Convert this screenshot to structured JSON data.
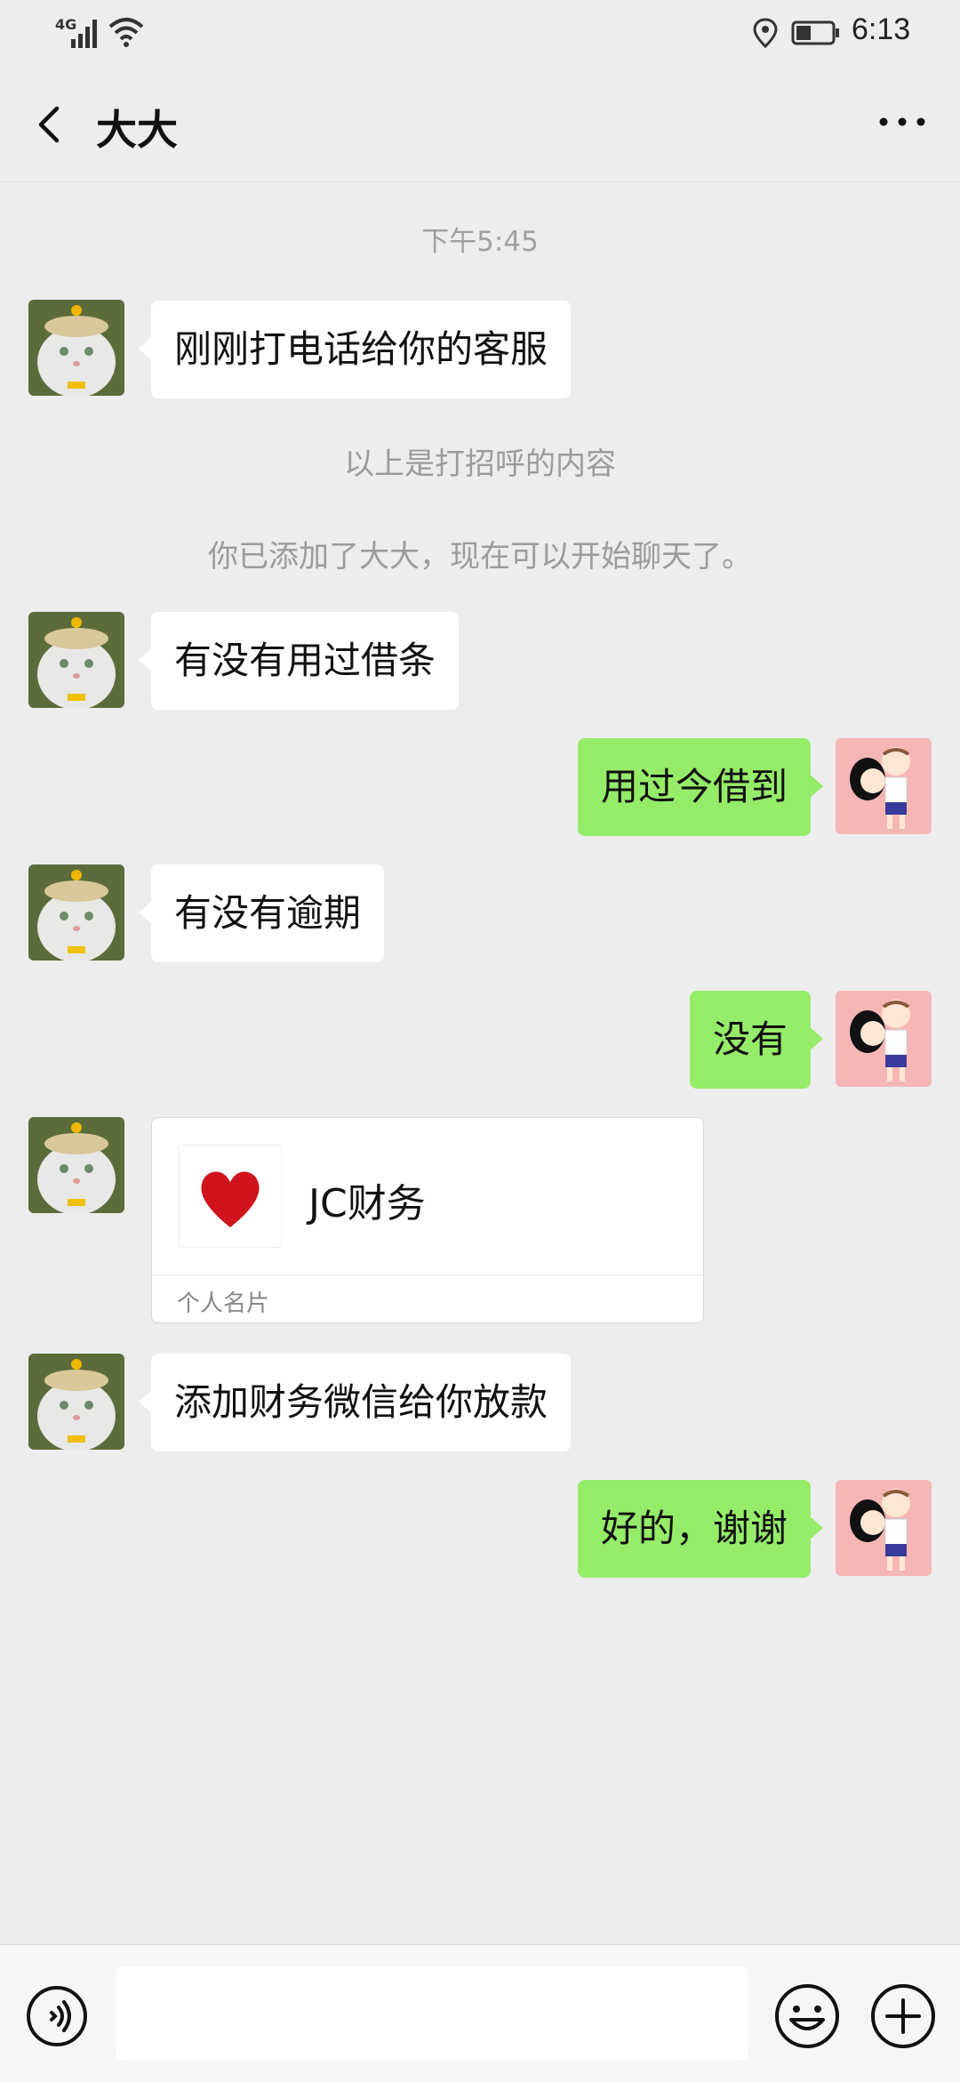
{
  "status_bar": {
    "network": "4G",
    "time": "6:13"
  },
  "header": {
    "title": "大大"
  },
  "messages": {
    "timestamp": "下午5:45",
    "m1": "刚刚打电话给你的客服",
    "greeting_note": "以上是打招呼的内容",
    "added_note": "你已添加了大大，现在可以开始聊天了。",
    "m2": "有没有用过借条",
    "m3": "用过今借到",
    "m4": "有没有逾期",
    "m5": "没有",
    "card": {
      "name": "JC财务",
      "label": "个人名片"
    },
    "m6": "添加财务微信给你放款",
    "m7": "好的，谢谢"
  },
  "input": {
    "value": ""
  },
  "colors": {
    "background": "#ededed",
    "outgoing_bubble": "#95ec69",
    "incoming_bubble": "#ffffff",
    "card_heart": "#d0121b"
  },
  "icons": {
    "voice": "voice-icon",
    "emoji": "emoji-icon",
    "plus": "plus-icon",
    "back": "back-arrow-icon",
    "more": "more-icon"
  }
}
